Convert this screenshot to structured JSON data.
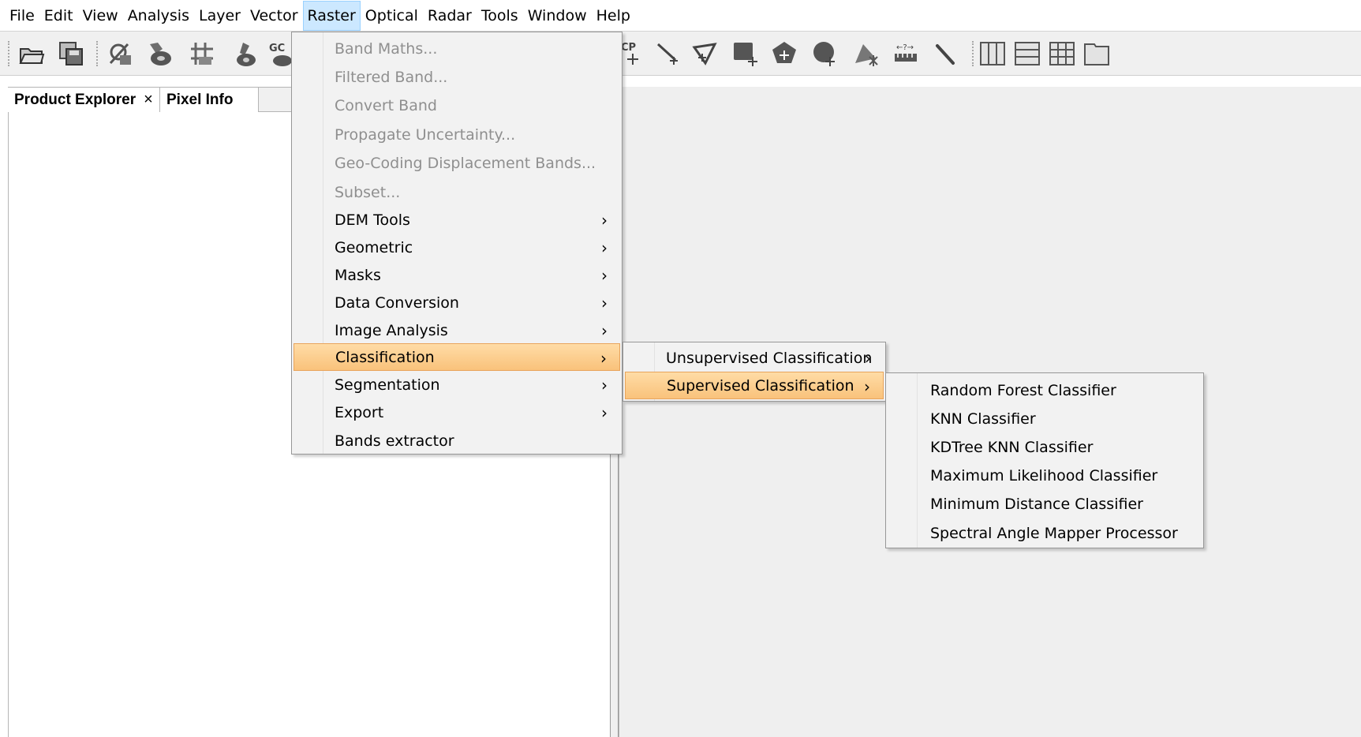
{
  "menubar": {
    "items": [
      "File",
      "Edit",
      "View",
      "Analysis",
      "Layer",
      "Vector",
      "Raster",
      "Optical",
      "Radar",
      "Tools",
      "Window",
      "Help"
    ],
    "active": "Raster"
  },
  "toolbar": {
    "gcp_label_1": "GC",
    "gcp_label_2": "CP",
    "icons": [
      "open-product-icon",
      "save-product-icon",
      "no-data-overlay-icon",
      "mask-icon",
      "grid-overlay-icon",
      "pin-manager-icon",
      "gcp-manager-icon",
      "add-gcp-icon",
      "line-draw-icon",
      "polyline-draw-icon",
      "rectangle-draw-icon",
      "polygon-draw-icon",
      "ellipse-draw-icon",
      "magic-wand-icon",
      "range-finder-icon",
      "select-tool-icon",
      "tile-evenly-icon",
      "tile-horizontally-icon",
      "tile-vertically-icon",
      "tile-single-icon"
    ]
  },
  "tabs": {
    "product_explorer": "Product Explorer",
    "close_glyph": "×",
    "pixel_info": "Pixel Info"
  },
  "raster_menu": {
    "items": [
      {
        "label": "Band Maths...",
        "enabled": false,
        "submenu": false
      },
      {
        "label": "Filtered Band...",
        "enabled": false,
        "submenu": false
      },
      {
        "label": "Convert Band",
        "enabled": false,
        "submenu": false
      },
      {
        "label": "Propagate Uncertainty...",
        "enabled": false,
        "submenu": false
      },
      {
        "label": "Geo-Coding Displacement Bands...",
        "enabled": false,
        "submenu": false
      },
      {
        "label": "Subset...",
        "enabled": false,
        "submenu": false
      },
      {
        "label": "DEM Tools",
        "enabled": true,
        "submenu": true
      },
      {
        "label": "Geometric",
        "enabled": true,
        "submenu": true
      },
      {
        "label": "Masks",
        "enabled": true,
        "submenu": true
      },
      {
        "label": "Data Conversion",
        "enabled": true,
        "submenu": true
      },
      {
        "label": "Image Analysis",
        "enabled": true,
        "submenu": true
      },
      {
        "label": "Classification",
        "enabled": true,
        "submenu": true,
        "highlighted": true
      },
      {
        "label": "Segmentation",
        "enabled": true,
        "submenu": true
      },
      {
        "label": "Export",
        "enabled": true,
        "submenu": true
      },
      {
        "label": "Bands extractor",
        "enabled": true,
        "submenu": false
      }
    ],
    "arrow_glyph": "›"
  },
  "classification_menu": {
    "items": [
      {
        "label": "Unsupervised Classification",
        "submenu": true
      },
      {
        "label": "Supervised Classification",
        "submenu": true,
        "highlighted": true
      }
    ]
  },
  "supervised_menu": {
    "items": [
      {
        "label": "Random Forest Classifier"
      },
      {
        "label": "KNN Classifier"
      },
      {
        "label": "KDTree KNN Classifier"
      },
      {
        "label": "Maximum Likelihood Classifier"
      },
      {
        "label": "Minimum Distance Classifier"
      },
      {
        "label": "Spectral Angle Mapper Processor"
      }
    ]
  },
  "colors": {
    "highlight_top": "#ffdca6",
    "highlight_bottom": "#f9c27b",
    "disabled_text": "#8f8f8f",
    "menubar_active": "#cce8ff"
  }
}
